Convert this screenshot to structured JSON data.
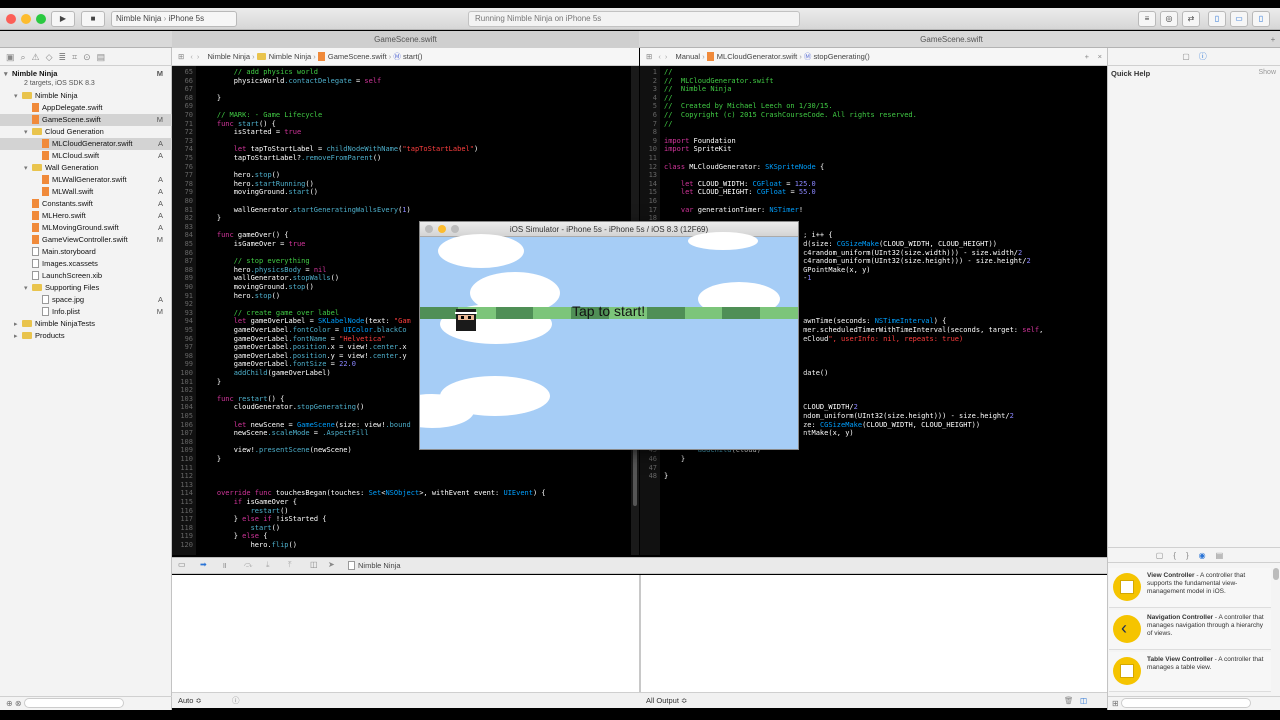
{
  "toolbar": {
    "scheme_project": "Nimble Ninja",
    "scheme_device": "iPhone 5s",
    "activity": "Running Nimble Ninja on iPhone 5s"
  },
  "tabs": {
    "left": "GameScene.swift",
    "right": "GameScene.swift"
  },
  "navigator": {
    "project": "Nimble Ninja",
    "project_sub": "2 targets, iOS SDK 8.3",
    "project_status": "M",
    "items": [
      {
        "label": "Nimble Ninja",
        "type": "folder",
        "indent": 1,
        "status": ""
      },
      {
        "label": "AppDelegate.swift",
        "type": "swift",
        "indent": 2,
        "status": ""
      },
      {
        "label": "GameScene.swift",
        "type": "swift",
        "indent": 2,
        "status": "M",
        "sel": true
      },
      {
        "label": "Cloud Generation",
        "type": "folder",
        "indent": 2,
        "status": ""
      },
      {
        "label": "MLCloudGenerator.swift",
        "type": "swift",
        "indent": 3,
        "status": "A",
        "sel2": true
      },
      {
        "label": "MLCloud.swift",
        "type": "swift",
        "indent": 3,
        "status": "A"
      },
      {
        "label": "Wall Generation",
        "type": "folder",
        "indent": 2,
        "status": ""
      },
      {
        "label": "MLWallGenerator.swift",
        "type": "swift",
        "indent": 3,
        "status": "A"
      },
      {
        "label": "MLWall.swift",
        "type": "swift",
        "indent": 3,
        "status": "A"
      },
      {
        "label": "Constants.swift",
        "type": "swift",
        "indent": 2,
        "status": "A"
      },
      {
        "label": "MLHero.swift",
        "type": "swift",
        "indent": 2,
        "status": "A"
      },
      {
        "label": "MLMovingGround.swift",
        "type": "swift",
        "indent": 2,
        "status": "A"
      },
      {
        "label": "GameViewController.swift",
        "type": "swift",
        "indent": 2,
        "status": "M"
      },
      {
        "label": "Main.storyboard",
        "type": "file",
        "indent": 2,
        "status": ""
      },
      {
        "label": "Images.xcassets",
        "type": "file",
        "indent": 2,
        "status": ""
      },
      {
        "label": "LaunchScreen.xib",
        "type": "file",
        "indent": 2,
        "status": ""
      },
      {
        "label": "Supporting Files",
        "type": "folder",
        "indent": 2,
        "status": ""
      },
      {
        "label": "space.jpg",
        "type": "file",
        "indent": 3,
        "status": "A"
      },
      {
        "label": "Info.plist",
        "type": "file",
        "indent": 3,
        "status": "M"
      },
      {
        "label": "Nimble NinjaTests",
        "type": "folder",
        "indent": 1,
        "status": ""
      },
      {
        "label": "Products",
        "type": "folder",
        "indent": 1,
        "status": ""
      }
    ]
  },
  "left_jump": {
    "a": "Nimble Ninja",
    "b": "Nimble Ninja",
    "c": "GameScene.swift",
    "d": "start()"
  },
  "right_jump": {
    "a": "Manual",
    "b": "MLCloudGenerator.swift",
    "c": "stopGenerating()"
  },
  "left_code": [
    [
      "65",
      "        // add physics world"
    ],
    [
      "66",
      "        physicsWorld.contactDelegate = self"
    ],
    [
      "67",
      ""
    ],
    [
      "68",
      "    }"
    ],
    [
      "69",
      ""
    ],
    [
      "70",
      "    // MARK: - Game Lifecycle"
    ],
    [
      "71",
      "    func start() {"
    ],
    [
      "72",
      "        isStarted = true"
    ],
    [
      "73",
      ""
    ],
    [
      "74",
      "        let tapToStartLabel = childNodeWithName(\"tapToStartLabel\")"
    ],
    [
      "75",
      "        tapToStartLabel?.removeFromParent()"
    ],
    [
      "76",
      ""
    ],
    [
      "77",
      "        hero.stop()"
    ],
    [
      "78",
      "        hero.startRunning()"
    ],
    [
      "79",
      "        movingGround.start()"
    ],
    [
      "80",
      ""
    ],
    [
      "81",
      "        wallGenerator.startGeneratingWallsEvery(1)"
    ],
    [
      "82",
      "    }"
    ],
    [
      "83",
      ""
    ],
    [
      "84",
      "    func gameOver() {"
    ],
    [
      "85",
      "        isGameOver = true"
    ],
    [
      "86",
      ""
    ],
    [
      "87",
      "        // stop everything"
    ],
    [
      "88",
      "        hero.physicsBody = nil"
    ],
    [
      "89",
      "        wallGenerator.stopWalls()"
    ],
    [
      "90",
      "        movingGround.stop()"
    ],
    [
      "91",
      "        hero.stop()"
    ],
    [
      "92",
      ""
    ],
    [
      "93",
      "        // create game over label"
    ],
    [
      "94",
      "        let gameOverLabel = SKLabelNode(text: \"Gam"
    ],
    [
      "95",
      "        gameOverLabel.fontColor = UIColor.blackCo"
    ],
    [
      "96",
      "        gameOverLabel.fontName = \"Helvetica\""
    ],
    [
      "97",
      "        gameOverLabel.position.x = view!.center.x"
    ],
    [
      "98",
      "        gameOverLabel.position.y = view!.center.y"
    ],
    [
      "99",
      "        gameOverLabel.fontSize = 22.0"
    ],
    [
      "100",
      "        addChild(gameOverLabel)"
    ],
    [
      "101",
      "    }"
    ],
    [
      "102",
      ""
    ],
    [
      "103",
      "    func restart() {"
    ],
    [
      "104",
      "        cloudGenerator.stopGenerating()"
    ],
    [
      "105",
      ""
    ],
    [
      "106",
      "        let newScene = GameScene(size: view!.bound"
    ],
    [
      "107",
      "        newScene.scaleMode = .AspectFill"
    ],
    [
      "108",
      ""
    ],
    [
      "109",
      "        view!.presentScene(newScene)"
    ],
    [
      "110",
      "    }"
    ],
    [
      "111",
      ""
    ],
    [
      "112",
      ""
    ],
    [
      "113",
      ""
    ],
    [
      "114",
      "    override func touchesBegan(touches: Set<NSObject>, withEvent event: UIEvent) {"
    ],
    [
      "115",
      "        if isGameOver {"
    ],
    [
      "116",
      "            restart()"
    ],
    [
      "117",
      "        } else if !isStarted {"
    ],
    [
      "118",
      "            start()"
    ],
    [
      "119",
      "        } else {"
    ],
    [
      "120",
      "            hero.flip()"
    ]
  ],
  "right_code": [
    [
      "1",
      "//"
    ],
    [
      "2",
      "//  MLCloudGenerator.swift"
    ],
    [
      "3",
      "//  Nimble Ninja"
    ],
    [
      "4",
      "//"
    ],
    [
      "5",
      "//  Created by Michael Leech on 1/30/15."
    ],
    [
      "6",
      "//  Copyright (c) 2015 CrashCourseCode. All rights reserved."
    ],
    [
      "7",
      "//"
    ],
    [
      "8",
      ""
    ],
    [
      "9",
      "import Foundation"
    ],
    [
      "10",
      "import SpriteKit"
    ],
    [
      "11",
      ""
    ],
    [
      "12",
      "class MLCloudGenerator: SKSpriteNode {"
    ],
    [
      "13",
      ""
    ],
    [
      "14",
      "    let CLOUD_WIDTH: CGFloat = 125.0"
    ],
    [
      "15",
      "    let CLOUD_HEIGHT: CGFloat = 55.0"
    ],
    [
      "16",
      ""
    ],
    [
      "17",
      "    var generationTimer: NSTimer!"
    ],
    [
      "18",
      ""
    ],
    [
      "19",
      ""
    ],
    [
      "20",
      "                                 ; i++ {"
    ],
    [
      "21",
      "                                 d(size: CGSizeMake(CLOUD_WIDTH, CLOUD_HEIGHT))"
    ],
    [
      "22",
      "                                 c4random_uniform(UInt32(size.width))) - size.width/2"
    ],
    [
      "23",
      "                                 c4random_uniform(UInt32(size.height))) - size.height/2"
    ],
    [
      "24",
      "                                 GPointMake(x, y)"
    ],
    [
      "25",
      "                                 -1"
    ],
    [
      "26",
      ""
    ],
    [
      "27",
      ""
    ],
    [
      "28",
      ""
    ],
    [
      "29",
      ""
    ],
    [
      "30",
      "                                 awnTime(seconds: NSTimeInterval) {"
    ],
    [
      "31",
      "                                 mer.scheduledTimerWithTimeInterval(seconds, target: self,"
    ],
    [
      "32",
      "                                 eCloud\", userInfo: nil, repeats: true)"
    ],
    [
      "33",
      ""
    ],
    [
      "34",
      ""
    ],
    [
      "35",
      ""
    ],
    [
      "36",
      "                                 date()"
    ],
    [
      "37",
      ""
    ],
    [
      "38",
      ""
    ],
    [
      "39",
      ""
    ],
    [
      "40",
      "                                 CLOUD_WIDTH/2"
    ],
    [
      "41",
      "                                 ndom_uniform(UInt32(size.height))) - size.height/2"
    ],
    [
      "42",
      "                                 ze: CGSizeMake(CLOUD_WIDTH, CLOUD_HEIGHT))"
    ],
    [
      "43",
      "                                 ntMake(x, y)"
    ],
    [
      "44",
      ""
    ],
    [
      "45",
      "        addChild(cloud)"
    ],
    [
      "46",
      "    }"
    ],
    [
      "47",
      ""
    ],
    [
      "48",
      "}"
    ]
  ],
  "simulator": {
    "title": "iOS Simulator - iPhone 5s - iPhone 5s / iOS 8.3 (12F69)",
    "prompt": "Tap to start!"
  },
  "debug": {
    "target": "Nimble Ninja",
    "auto": "Auto ≎",
    "all_output": "All Output ≎"
  },
  "inspector": {
    "quick_help": "Quick Help",
    "show": "Show",
    "library": [
      {
        "title": "View Controller",
        "desc": " - A controller that supports the fundamental view-management model in iOS."
      },
      {
        "title": "Navigation Controller",
        "desc": " - A controller that manages navigation through a hierarchy of views."
      },
      {
        "title": "Table View Controller",
        "desc": " - A controller that manages a table view."
      }
    ]
  },
  "colors": {
    "comment": "#41cc45",
    "keyword": "#d2359b",
    "type": "#00a0ff",
    "string": "#ff3f3f",
    "number": "#8b87ff",
    "sky": "#a6cdf6",
    "ground_light": "#7cc57a",
    "ground_dark": "#4f8f56"
  }
}
